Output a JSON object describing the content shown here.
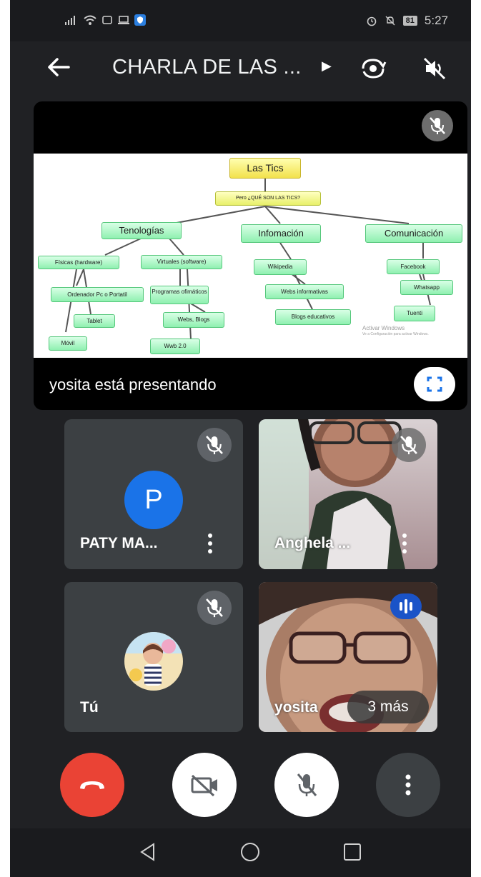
{
  "status_bar": {
    "battery": "81",
    "time": "5:27"
  },
  "header": {
    "title": "CHARLA DE LAS ..."
  },
  "presentation": {
    "presenter_label": "yosita está presentando",
    "slide": {
      "root": "Las Tics",
      "question": "Pero ¿QUÉ SON LAS TICS?",
      "branches": [
        {
          "label": "Tenologías"
        },
        {
          "label": "Infomación"
        },
        {
          "label": "Comunicación"
        }
      ],
      "tec_nodes": [
        "Físicas (hardware)",
        "Virtuales (software)",
        "Ordenador Pc o Portatil",
        "Tablet",
        "Móvil",
        "Programas ofimáticos",
        "Webs, Blogs",
        "Wwb 2.0"
      ],
      "info_nodes": [
        "Wikipedia",
        "Webs informativas",
        "Blogs educativos"
      ],
      "com_nodes": [
        "Facebook",
        "Whatsapp",
        "Tuenti"
      ],
      "watermark_line1": "Activar Windows",
      "watermark_line2": "Ve a Configuración para activar Windows."
    }
  },
  "participants": [
    {
      "name": "PATY MA...",
      "initial": "P",
      "avatar_color": "#1a73e8"
    },
    {
      "name": "Anghela ..."
    },
    {
      "name": "Tú"
    },
    {
      "name": "yosita",
      "more": "3 más"
    }
  ],
  "icons": {
    "back": "arrow-left-icon",
    "switch_camera": "camera-switch-icon",
    "audio_off": "speaker-off-icon",
    "mic_off": "mic-off-icon",
    "fullscreen": "fullscreen-icon",
    "end_call": "hang-up-icon",
    "video_off": "video-off-icon",
    "more": "more-vertical-icon",
    "speaking": "speaking-indicator-icon"
  },
  "colors": {
    "end_call": "#ea4335",
    "avatar": "#1a73e8",
    "speaking": "#1a53c8"
  }
}
